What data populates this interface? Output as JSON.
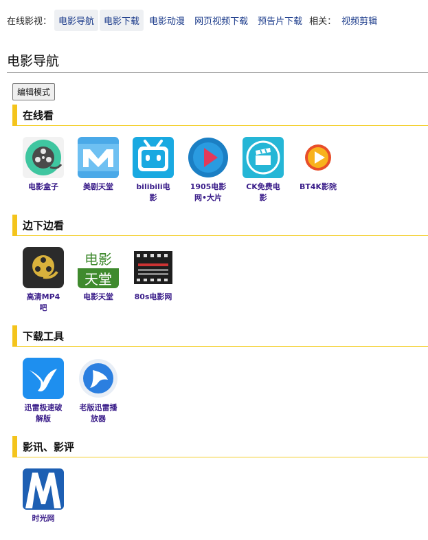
{
  "topnav": {
    "prefix": "在线影视：",
    "links": [
      "电影导航",
      "电影下载",
      "电影动漫",
      "网页视频下载",
      "预告片下载"
    ],
    "related_label": "相关：",
    "related_link": "视频剪辑"
  },
  "page_title": "电影导航",
  "edit_button": "编辑模式",
  "sections": [
    {
      "title": "在线看",
      "items": [
        {
          "label": "电影盒子",
          "icon": "film-reel-icon"
        },
        {
          "label": "美剧天堂",
          "icon": "meiju-logo-icon"
        },
        {
          "label": "bilibili电影",
          "icon": "bilibili-icon"
        },
        {
          "label": "1905电影网•大片",
          "icon": "play-circle-icon"
        },
        {
          "label": "CK免费电影",
          "icon": "clapperboard-icon"
        },
        {
          "label": "BT4K影院",
          "icon": "play-button-orange-icon"
        }
      ]
    },
    {
      "title": "边下边看",
      "items": [
        {
          "label": "高清MP4吧",
          "icon": "film-reel-dark-icon"
        },
        {
          "label": "电影天堂",
          "icon": "dytt-logo-icon",
          "icon_text": [
            "电影",
            "天堂"
          ]
        },
        {
          "label": "80s电影网",
          "icon": "film-strip-icon"
        }
      ]
    },
    {
      "title": "下载工具",
      "items": [
        {
          "label": "迅雷极速破解版",
          "icon": "xunlei-bird-icon"
        },
        {
          "label": "老版迅雷播放器",
          "icon": "xunlei-player-icon"
        }
      ]
    },
    {
      "title": "影讯、影评",
      "items": [
        {
          "label": "时光网",
          "icon": "mtime-logo-icon"
        }
      ]
    }
  ]
}
